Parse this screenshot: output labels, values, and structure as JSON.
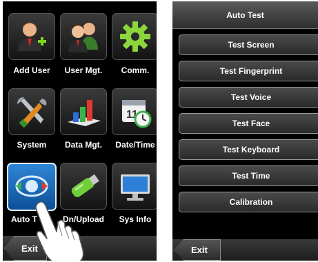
{
  "left_screen": {
    "tiles": [
      {
        "label": "Add User",
        "icon": "add-user-icon"
      },
      {
        "label": "User Mgt.",
        "icon": "user-management-icon"
      },
      {
        "label": "Comm.",
        "icon": "gear-icon"
      },
      {
        "label": "System",
        "icon": "tools-icon"
      },
      {
        "label": "Data Mgt.",
        "icon": "bar-chart-icon"
      },
      {
        "label": "Date/Time",
        "icon": "calendar-clock-icon"
      },
      {
        "label": "Auto T",
        "icon": "auto-test-icon"
      },
      {
        "label": "Dn/Upload",
        "icon": "usb-drive-icon"
      },
      {
        "label": "Sys Info",
        "icon": "monitor-icon"
      }
    ],
    "selected_tile": "Auto T",
    "exit_label": "Exit"
  },
  "right_screen": {
    "title": "Auto Test",
    "items": [
      {
        "label": "Test Screen"
      },
      {
        "label": "Test Fingerprint"
      },
      {
        "label": "Test Voice"
      },
      {
        "label": "Test Face"
      },
      {
        "label": "Test Keyboard"
      },
      {
        "label": "Test Time"
      },
      {
        "label": "Calibration"
      }
    ],
    "exit_label": "Exit"
  },
  "colors": {
    "background": "#000000",
    "selected_tile": "#1f6fbf",
    "text": "#ffffff"
  }
}
